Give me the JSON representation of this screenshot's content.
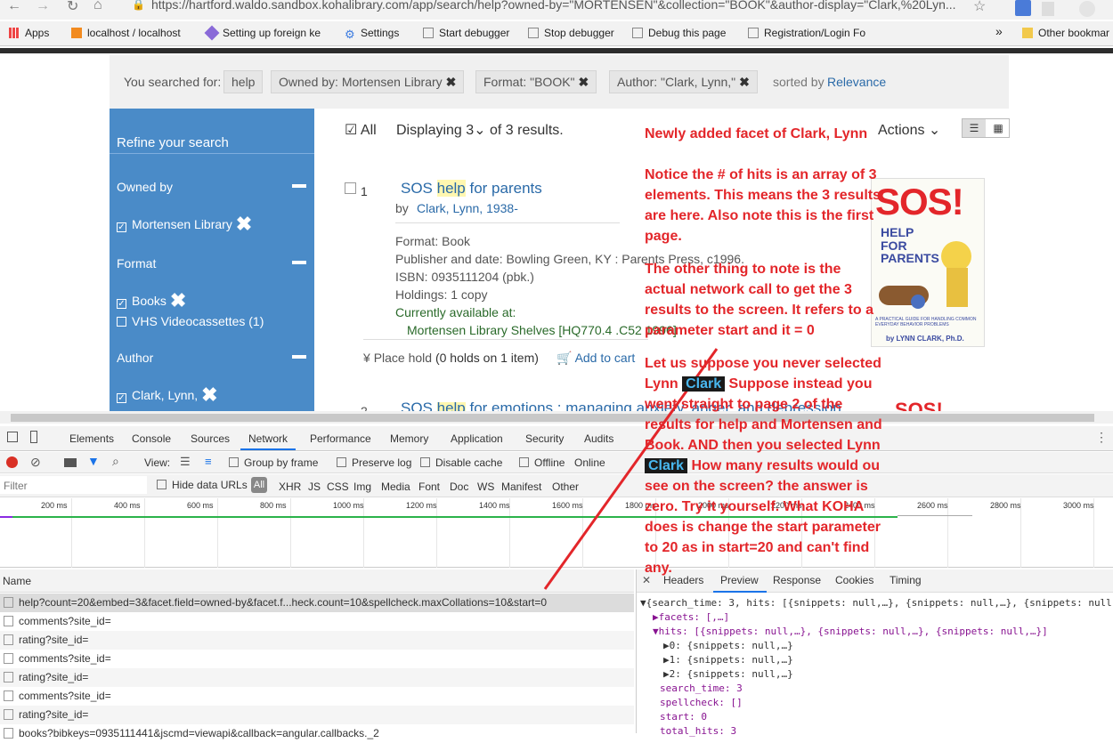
{
  "browser": {
    "url": "https://hartford.waldo.sandbox.kohalibrary.com/app/search/help?owned-by=\"MORTENSEN\"&collection=\"BOOK\"&author-display=\"Clark,%20Lyn...",
    "bookmarks": [
      "Apps",
      "localhost / localhost",
      "Setting up foreign ke",
      "Settings",
      "Start debugger",
      "Stop debugger",
      "Debug this page",
      "Registration/Login Fo",
      "Other bookmar"
    ]
  },
  "search": {
    "prefix": "You searched for:",
    "chips": [
      "help",
      "Owned by: Mortensen Library",
      "Format: \"BOOK\"",
      "Author: \"Clark, Lynn,\""
    ],
    "sorted_by_label": "sorted by",
    "sorted_by_value": "Relevance"
  },
  "sidebar": {
    "title": "Refine your search",
    "owned_by": "Owned by",
    "owned_item": "Mortensen Library",
    "format": "Format",
    "format_items": [
      "Books",
      "VHS Videocassettes (1)"
    ],
    "author": "Author",
    "author_item": "Clark, Lynn,"
  },
  "results": {
    "all": "All",
    "displaying": "Displaying 3",
    "of": "of 3 results.",
    "actions": "Actions",
    "item1": {
      "num": "1",
      "title_pre": "SOS ",
      "title_hl": "help",
      "title_post": " for parents",
      "by": "by",
      "author": "Clark, Lynn, 1938-",
      "format": "Format: Book",
      "publisher": "Publisher and date:   Bowling Green, KY : Parents Press, c1996.",
      "isbn": "ISBN:   0935111204 (pbk.)",
      "holdings": "Holdings: 1 copy",
      "avail": "Currently available at:",
      "location": "Mortensen Library Shelves [HQ770.4 .C52 1996]",
      "place_hold": "Place hold",
      "holds_info": "(0 holds on 1 item)",
      "add_cart": "Add to cart"
    },
    "item2": {
      "num": "2",
      "title_pre": "SOS ",
      "title_hl": "help",
      "title_post": " for emotions : managing anxiety, anger, and depression"
    }
  },
  "cover": {
    "big": "SOS!",
    "line1": "HELP",
    "line2": "FOR",
    "line3": "PARENTS",
    "sub": "A PRACTICAL GUIDE FOR HANDLING COMMON EVERYDAY BEHAVIOR PROBLEMS",
    "author": "by LYNN CLARK, Ph.D."
  },
  "annotation": {
    "l1": "Newly added facet of  Clark, Lynn",
    "l2": "Notice the # of hits is an array of 3",
    "l3": "elements. This means the 3 results",
    "l4": "are here. Also note this is the first",
    "l5": "page.",
    "l6": "The other thing to note is the",
    "l7": "actual network call to get the 3",
    "l8": "results to the screen. It refers to a",
    "l9": "parameter start and it = 0",
    "l10a": "Let us suppose you never selected",
    "l11a": "Lynn",
    "l11b": "Clark",
    "l11c": " Suppose instead you",
    "l12": "went straight to page 2 of the",
    "l13": "results for help and Mortensen and",
    "l14": "Book. AND then you selected Lynn",
    "l15a": "Clark",
    "l15b": "  How many results would ou",
    "l16": "see on the screen? the answer is",
    "l17": "zero.  Try it yourself.  What KOHA",
    "l18": "does is change the start parameter",
    "l19": "to 20 as in start=20 and can't find",
    "l20": "any."
  },
  "devtools": {
    "tabs": [
      "Elements",
      "Console",
      "Sources",
      "Network",
      "Performance",
      "Memory",
      "Application",
      "Security",
      "Audits"
    ],
    "view": "View:",
    "group_by_frame": "Group by frame",
    "preserve_log": "Preserve log",
    "disable_cache": "Disable cache",
    "offline": "Offline",
    "online": "Online",
    "filter_placeholder": "Filter",
    "hide_data": "Hide data URLs",
    "filters": [
      "All",
      "XHR",
      "JS",
      "CSS",
      "Img",
      "Media",
      "Font",
      "Doc",
      "WS",
      "Manifest",
      "Other"
    ],
    "ticks": [
      "200 ms",
      "400 ms",
      "600 ms",
      "800 ms",
      "1000 ms",
      "1200 ms",
      "1400 ms",
      "1600 ms",
      "1800 ms",
      "2000 ms",
      "2200 ms",
      "2400 ms",
      "2600 ms",
      "2800 ms",
      "3000 ms"
    ],
    "name_header": "Name",
    "requests": [
      "help?count=20&embed=3&facet.field=owned-by&facet.f...heck.count=10&spellcheck.maxCollations=10&start=0",
      "comments?site_id=",
      "rating?site_id=",
      "comments?site_id=",
      "rating?site_id=",
      "comments?site_id=",
      "rating?site_id=",
      "books?bibkeys=0935111441&jscmd=viewapi&callback=angular.callbacks._2"
    ],
    "preview_tabs": [
      "Headers",
      "Preview",
      "Response",
      "Cookies",
      "Timing"
    ],
    "preview": {
      "root": "{search_time: 3, hits: [{snippets: null,…}, {snippets: null,…}, {snippets: null",
      "facets": "facets: [,…]",
      "hits": "hits: [{snippets: null,…}, {snippets: null,…}, {snippets: null,…}]",
      "h0": "0: {snippets: null,…}",
      "h1": "1: {snippets: null,…}",
      "h2": "2: {snippets: null,…}",
      "search_time": "search_time: 3",
      "spellcheck": "spellcheck: []",
      "start": "start: 0",
      "total_hits": "total_hits: 3"
    }
  }
}
